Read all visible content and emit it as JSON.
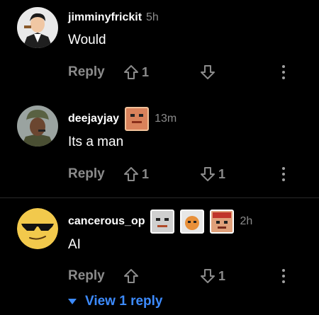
{
  "colors": {
    "background": "#000000",
    "muted": "#8b8b8b",
    "link": "#3d8bfd"
  },
  "comments": [
    {
      "username": "jimminyfrickit",
      "time": "5h",
      "body": "Would",
      "reply_label": "Reply",
      "upvotes": "1",
      "downvotes": "",
      "flairs": []
    },
    {
      "username": "deejayjay",
      "time": "13m",
      "body": "Its a man",
      "reply_label": "Reply",
      "upvotes": "1",
      "downvotes": "1",
      "flairs": [
        "orange-face-flair"
      ]
    },
    {
      "username": "cancerous_op",
      "time": "2h",
      "body": "AI",
      "reply_label": "Reply",
      "upvotes": "",
      "downvotes": "1",
      "flairs": [
        "gray-face-flair",
        "orange-cat-flair",
        "red-face-flair"
      ]
    }
  ],
  "view_replies_label": "View 1 reply"
}
